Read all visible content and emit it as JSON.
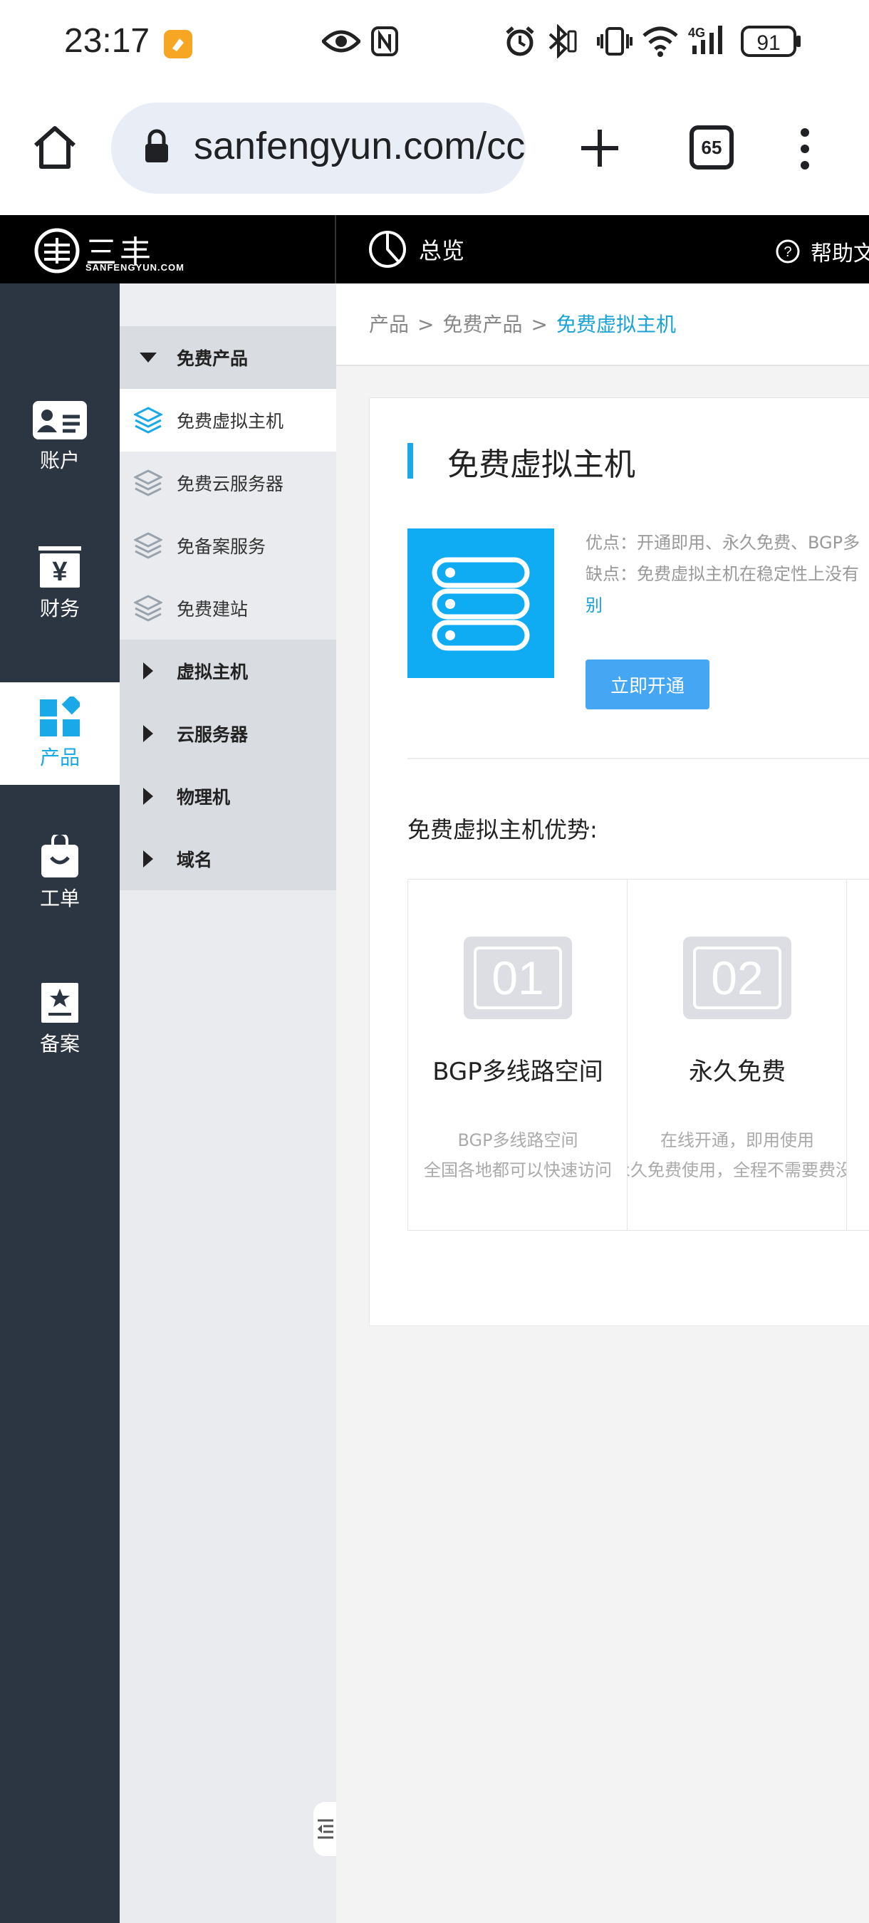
{
  "status_bar": {
    "time": "23:17",
    "battery": "91",
    "network": "4G",
    "icons": [
      "app-notification-icon",
      "eye-icon",
      "nfc-icon",
      "alarm-icon",
      "bluetooth-icon",
      "vibrate-icon",
      "wifi-icon",
      "cellular-signal-icon",
      "battery-icon"
    ]
  },
  "browser": {
    "url": "sanfengyun.com/cc",
    "tab_count": "65",
    "icons": [
      "home-icon",
      "lock-icon",
      "plus-icon",
      "tabs-icon",
      "more-vert-icon"
    ]
  },
  "header": {
    "logo_text": "三丰云",
    "logo_subtext": "SANFENGYUN.COM",
    "overview_label": "总览",
    "help_label": "帮助文"
  },
  "rail": {
    "items": [
      {
        "label": "账户",
        "icon": "account-card-icon"
      },
      {
        "label": "财务",
        "icon": "yen-icon"
      },
      {
        "label": "产品",
        "icon": "product-grid-icon",
        "active": true
      },
      {
        "label": "工单",
        "icon": "ticket-bag-icon"
      },
      {
        "label": "备案",
        "icon": "record-star-icon"
      }
    ]
  },
  "submenu": {
    "items": [
      {
        "label": "免费产品",
        "type": "group",
        "expanded": true
      },
      {
        "label": "免费虚拟主机",
        "type": "sub",
        "selected": true
      },
      {
        "label": "免费云服务器",
        "type": "sub"
      },
      {
        "label": "免备案服务",
        "type": "sub"
      },
      {
        "label": "免费建站",
        "type": "sub"
      },
      {
        "label": "虚拟主机",
        "type": "group"
      },
      {
        "label": "云服务器",
        "type": "group"
      },
      {
        "label": "物理机",
        "type": "group"
      },
      {
        "label": "域名",
        "type": "group"
      }
    ]
  },
  "breadcrumb": {
    "items": [
      "产品",
      "免费产品",
      "免费虚拟主机"
    ],
    "separator": ">"
  },
  "product": {
    "title": "免费虚拟主机",
    "desc_line1": "优点：开通即用、永久免费、BGP多",
    "desc_line2": "缺点：免费虚拟主机在稳定性上没有",
    "desc_line3": "别",
    "open_button": "立即开通",
    "advantages_title": "免费虚拟主机优势:",
    "features": [
      {
        "num": "01",
        "name": "BGP多线路空间",
        "desc1": "BGP多线路空间",
        "desc2": "全国各地都可以快速访问"
      },
      {
        "num": "02",
        "name": "永久免费",
        "desc1": "在线开通，即用使用",
        "desc2": "永久免费使用，全程不需要费没有"
      }
    ]
  },
  "colors": {
    "accent": "#19a9e8",
    "button": "#45a6f3",
    "rail_bg": "#2c3542",
    "product_icon_bg": "#10acf3"
  }
}
